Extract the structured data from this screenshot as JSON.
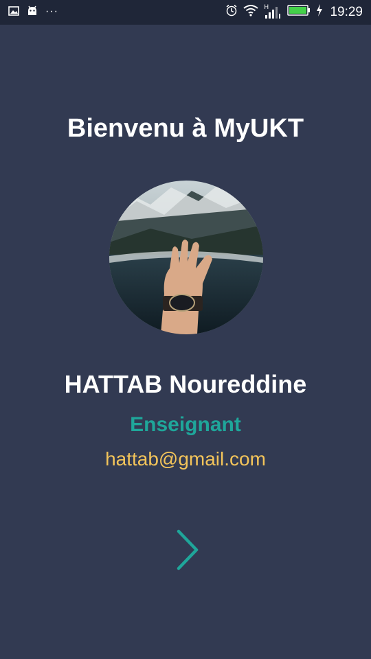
{
  "status_bar": {
    "time": "19:29",
    "left_icons": [
      "image-icon",
      "android-icon",
      "more-dots-icon"
    ],
    "right_icons": [
      "alarm-icon",
      "wifi-icon",
      "signal-icon",
      "battery-icon",
      "charging-icon"
    ],
    "more_dots": "···",
    "network_label": "H"
  },
  "welcome": {
    "title": "Bienvenu à MyUKT",
    "user_name": "HATTAB Noureddine",
    "role": "Enseignant",
    "email": "hattab@gmail.com",
    "avatar_alt": "profile photo"
  },
  "navigation": {
    "next_icon": "chevron-right-icon"
  },
  "colors": {
    "background": "#323a52",
    "status_bar": "#1f2638",
    "role_accent": "#1fa69a",
    "email_accent": "#f3c45a",
    "battery": "#44d14a"
  }
}
